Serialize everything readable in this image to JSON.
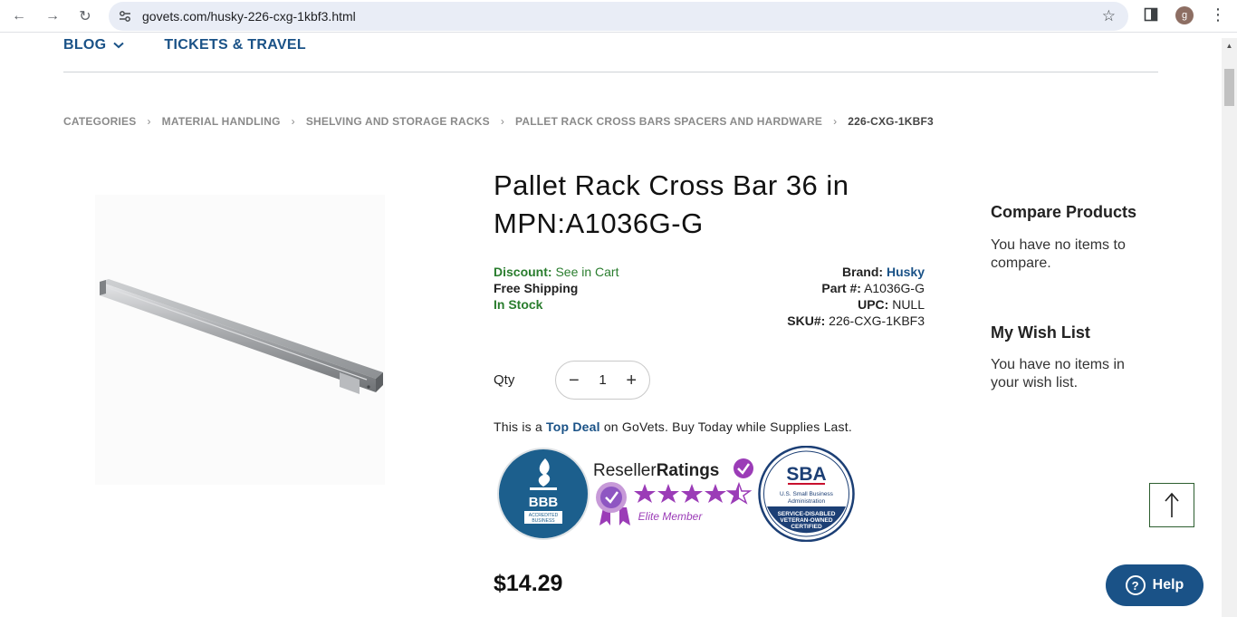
{
  "browser": {
    "url": "govets.com/husky-226-cxg-1kbf3.html",
    "profile_initial": "g"
  },
  "topnav": {
    "items": [
      {
        "label": "BLOG"
      },
      {
        "label": "TICKETS & TRAVEL"
      }
    ]
  },
  "breadcrumb": [
    "CATEGORIES",
    "MATERIAL HANDLING",
    "SHELVING AND STORAGE RACKS",
    "PALLET RACK CROSS BARS SPACERS AND HARDWARE",
    "226-CXG-1KBF3"
  ],
  "product": {
    "title_line1": "Pallet Rack Cross Bar 36 in",
    "title_line2": "MPN:A1036G-G",
    "discount_label": "Discount:",
    "discount_value": "See in Cart",
    "shipping": "Free Shipping",
    "stock": "In Stock",
    "brand_label": "Brand:",
    "brand_value": "Husky",
    "part_label": "Part #:",
    "part_value": "A1036G-G",
    "upc_label": "UPC:",
    "upc_value": "NULL",
    "sku_label": "SKU#:",
    "sku_value": "226-CXG-1KBF3",
    "qty_label": "Qty",
    "qty_value": "1",
    "deal_prefix": "This is a",
    "deal_highlight": "Top Deal",
    "deal_suffix": "on GoVets. Buy Today while Supplies Last.",
    "price": "$14.29"
  },
  "badges": {
    "bbb_title": "BBB",
    "bbb_sub1": "ACCREDITED",
    "bbb_sub2": "BUSINESS",
    "reseller_name_a": "Reseller",
    "reseller_name_b": "Ratings",
    "reseller_tier": "Elite Member",
    "sba_title": "SBA",
    "sba_line1": "U.S. Small Business",
    "sba_line2": "Administration",
    "sba_line3": "SERVICE-DISABLED",
    "sba_line4": "VETERAN-OWNED",
    "sba_line5": "CERTIFIED"
  },
  "sidebar": {
    "compare_title": "Compare Products",
    "compare_text": "You have no items to compare.",
    "wishlist_title": "My Wish List",
    "wishlist_text": "You have no items in your wish list."
  },
  "help": {
    "label": "Help"
  },
  "colors": {
    "brand_blue": "#1a5287",
    "green": "#2a7d2e",
    "reseller_purple": "#9b3cb7"
  }
}
